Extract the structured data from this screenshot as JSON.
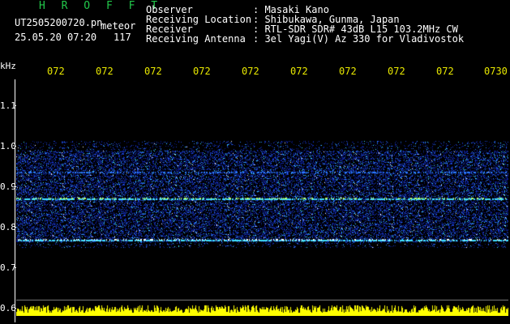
{
  "header": {
    "logo": "H R O F F T",
    "filename": "UT2505200720.pn",
    "tag": "meteor",
    "datetime": "25.05.20 07:20",
    "count": "117",
    "fields": [
      {
        "label": "Observer",
        "value": ": Masaki Kano"
      },
      {
        "label": "Receiving Location",
        "value": ": Shibukawa, Gunma, Japan"
      },
      {
        "label": "Receiver",
        "value": ": RTL-SDR SDR# 43dB L15 103.2MHz CW"
      },
      {
        "label": "Receiving Antenna",
        "value": ": 3el Yagi(V) Az 330 for Vladivostok"
      }
    ]
  },
  "axis": {
    "unit": "kHz",
    "y_ticks": [
      "1.1",
      "1.0",
      "0.9",
      "0.8",
      "0.7",
      "0.6"
    ],
    "x_ticks": [
      "072",
      "072",
      "072",
      "072",
      "072",
      "072",
      "072",
      "072",
      "072",
      "0730"
    ]
  },
  "colors": {
    "background": "#000000",
    "text": "#ffffff",
    "logo": "#22c84a",
    "tick": "#e8e800",
    "noise_low": "#0a1a8c",
    "noise_high": "#3fe0ff",
    "bottom_bars": "#ffff00"
  }
}
